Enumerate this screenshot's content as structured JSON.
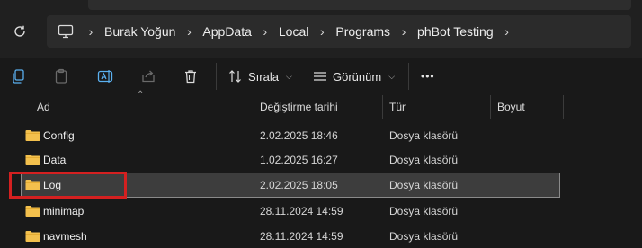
{
  "address": {
    "crumbs": [
      "Burak Yoğun",
      "AppData",
      "Local",
      "Programs",
      "phBot Testing"
    ]
  },
  "toolbar": {
    "sort_label": "Sırala",
    "view_label": "Görünüm",
    "more_label": "•••"
  },
  "columns": {
    "name": "Ad",
    "modified": "Değiştirme tarihi",
    "type": "Tür",
    "size": "Boyut"
  },
  "files": [
    {
      "name": "Config",
      "modified": "2.02.2025 18:46",
      "type": "Dosya klasörü"
    },
    {
      "name": "Data",
      "modified": "1.02.2025 16:27",
      "type": "Dosya klasörü"
    },
    {
      "name": "Log",
      "modified": "2.02.2025 18:05",
      "type": "Dosya klasörü"
    },
    {
      "name": "minimap",
      "modified": "28.11.2024 14:59",
      "type": "Dosya klasörü"
    },
    {
      "name": "navmesh",
      "modified": "28.11.2024 14:59",
      "type": "Dosya klasörü"
    }
  ],
  "colors": {
    "folder": "#f3c04d",
    "highlight": "#d42020",
    "selected_row": "#3d3d3d"
  }
}
